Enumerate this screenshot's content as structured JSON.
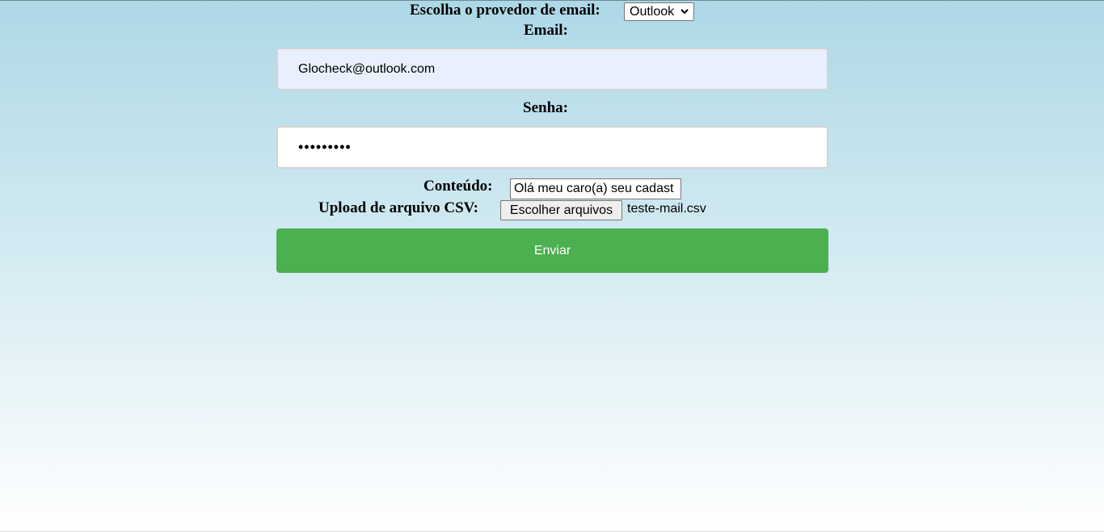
{
  "form": {
    "provider_label": "Escolha o provedor de email:",
    "provider_selected": "Outlook",
    "email_label": "Email:",
    "email_value": "Glocheck@outlook.com",
    "password_label": "Senha:",
    "password_value": "•••••••••",
    "content_label": "Conteúdo:",
    "content_value": "Olá meu caro(a) seu cadast",
    "upload_label": "Upload de arquivo CSV:",
    "file_button_label": "Escolher arquivos",
    "file_name": "teste-mail.csv",
    "submit_label": "Enviar"
  },
  "colors": {
    "background_top": "#add8e6",
    "background_bottom": "#ffffff",
    "submit_button": "#4caf50",
    "autofill_input": "#e8f0fe"
  },
  "icons": {
    "select_arrow": "chevron-down-icon"
  }
}
